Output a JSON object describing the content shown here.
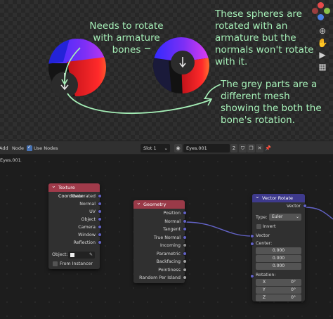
{
  "viewport": {
    "annotations": {
      "left": "Needs to rotate\nwith armature\nbones",
      "top_right": "These spheres are\nrotated with an\narmature but the\nnormals won't rotate\nwith it.",
      "bottom_right": "The grey parts are a\ndifferent mesh\nshowing the both the\nbone's rotation."
    },
    "gizmo_icons": [
      "zoom-icon",
      "hand-icon",
      "camera-icon",
      "grid-icon"
    ],
    "axis_colors": {
      "x": "#e54b4b",
      "y": "#8bc34a",
      "z": "#4a7fe5"
    }
  },
  "header": {
    "menu": [
      "Add",
      "Node"
    ],
    "use_nodes_label": "Use Nodes",
    "slot": "Slot 1",
    "material_name": "Eyes.001",
    "user_count": "2"
  },
  "breadcrumb": "Eyes.001",
  "nodes": {
    "texture_coordinate": {
      "title": "Texture Coordinate",
      "header_color": "#a03a4a",
      "outputs": [
        "Generated",
        "Normal",
        "UV",
        "Object",
        "Camera",
        "Window",
        "Reflection"
      ],
      "object_label": "Object:",
      "from_instancer": "From Instancer"
    },
    "geometry": {
      "title": "Geometry",
      "header_color": "#9a3a48",
      "outputs": [
        "Position",
        "Normal",
        "Tangent",
        "True Normal",
        "Incoming",
        "Parametric",
        "Backfacing",
        "Pointiness",
        "Random Per Island"
      ]
    },
    "vector_rotate": {
      "title": "Vector Rotate",
      "header_color": "#3e3a8c",
      "output": "Vector",
      "type_label": "Type:",
      "type_value": "Euler",
      "invert_label": "Invert",
      "vector_label": "Vector",
      "center_label": "Center:",
      "center_values": [
        "0.000",
        "0.000",
        "0.000"
      ],
      "rotation_label": "Rotation:",
      "rotation": [
        {
          "axis": "X",
          "value": "0°"
        },
        {
          "axis": "Y",
          "value": "0°"
        },
        {
          "axis": "Z",
          "value": "0°"
        }
      ]
    }
  }
}
